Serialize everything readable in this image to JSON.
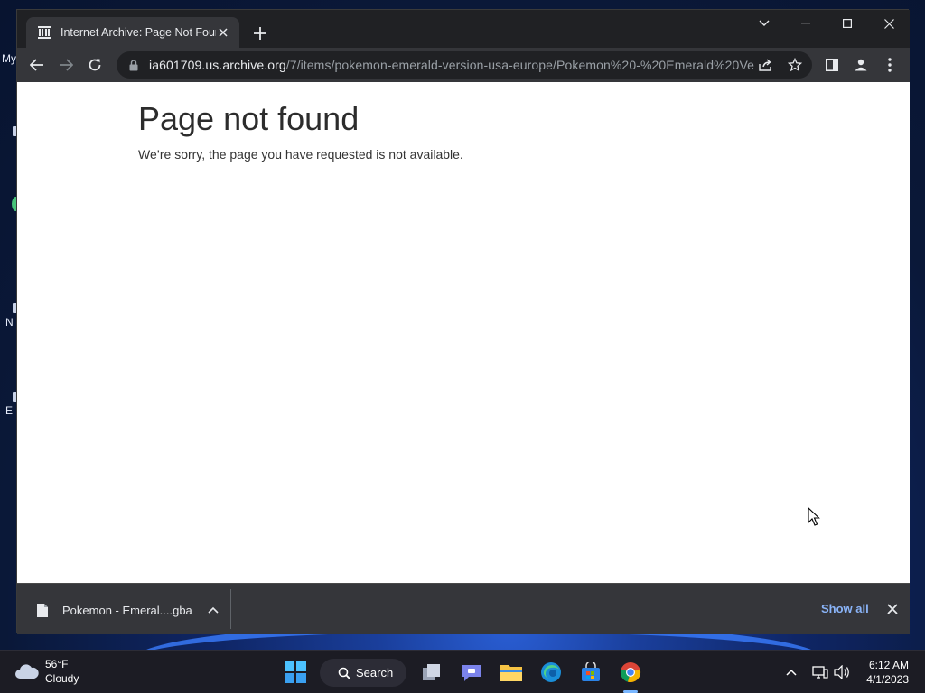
{
  "desktop": {
    "icons": [
      {
        "label": "My"
      },
      {
        "label": ""
      },
      {
        "label": ""
      },
      {
        "label": "N"
      },
      {
        "label": "E"
      }
    ]
  },
  "browser": {
    "tab_title": "Internet Archive: Page Not Found",
    "url_host": "ia601709.us.archive.org",
    "url_path": "/7/items/pokemon-emerald-version-usa-europe/Pokemon%20-%20Emerald%20Ve..."
  },
  "page": {
    "heading": "Page not found",
    "message": "We’re sorry, the page you have requested is not available."
  },
  "downloads": {
    "file_name": "Pokemon - Emeral....gba",
    "show_all_label": "Show all"
  },
  "taskbar": {
    "weather_temp": "56°F",
    "weather_desc": "Cloudy",
    "search_label": "Search",
    "time": "6:12 AM",
    "date": "4/1/2023"
  }
}
